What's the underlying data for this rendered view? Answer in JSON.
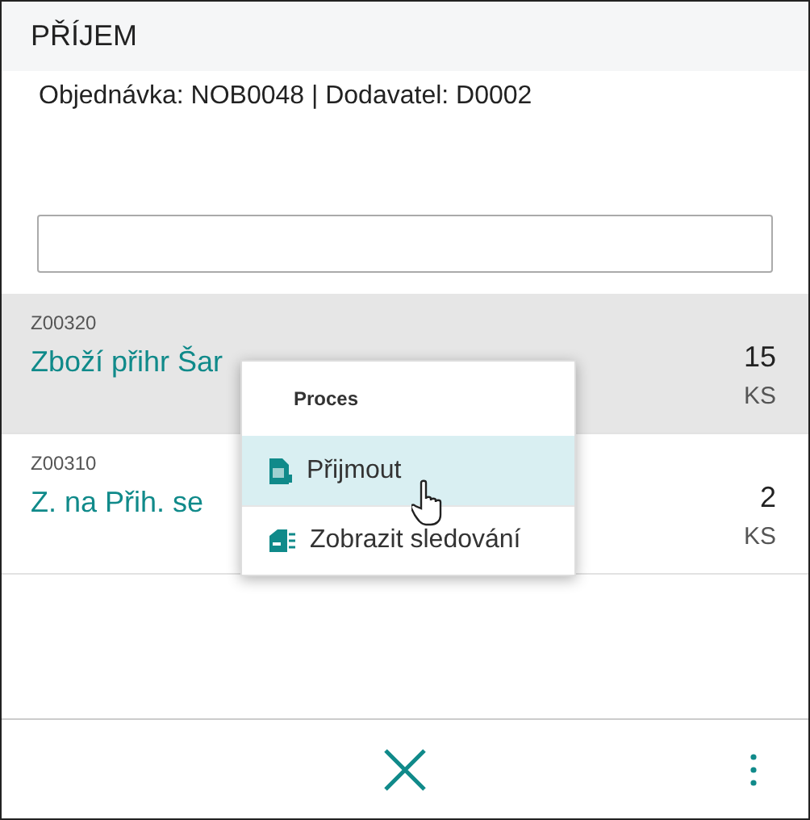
{
  "header": {
    "title": "PŘÍJEM",
    "subtitle": "Objednávka: NOB0048 | Dodavatel: D0002"
  },
  "rows": [
    {
      "code": "Z00320",
      "name": "Zboží přihr Šar",
      "quantity": "15",
      "unit": "KS",
      "selected": true
    },
    {
      "code": "Z00310",
      "name": "Z. na Přih. se",
      "quantity": "2",
      "unit": "KS",
      "selected": false
    }
  ],
  "context_menu": {
    "title": "Proces",
    "items": [
      {
        "label": "Přijmout",
        "kind": "receive",
        "selected": true
      },
      {
        "label": "Zobrazit sledování",
        "kind": "tracking",
        "selected": false
      }
    ]
  }
}
